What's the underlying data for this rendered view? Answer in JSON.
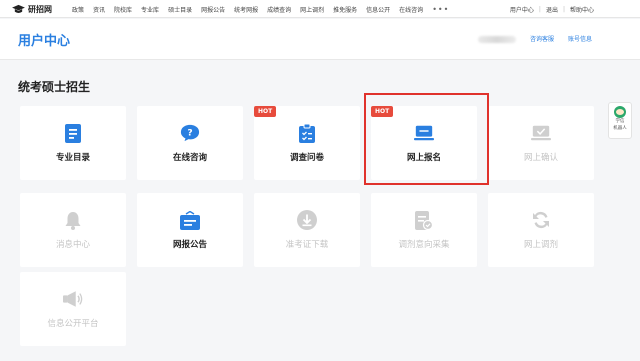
{
  "logo": {
    "text": "研招网"
  },
  "nav": {
    "items": [
      "政策",
      "资讯",
      "院校库",
      "专业库",
      "硕士目录",
      "网报公告",
      "统考网报",
      "成绩查询",
      "网上调剂",
      "推免服务",
      "信息公开",
      "在线咨询"
    ],
    "more": "•••"
  },
  "toplinks": {
    "user_center": "用户中心",
    "logout": "退出",
    "help": "帮助中心",
    "separator": "|"
  },
  "header": {
    "title": "用户中心",
    "consult_link": "咨询客服",
    "account_link": "账号信息"
  },
  "section": {
    "title": "统考硕士招生"
  },
  "cards": [
    {
      "label": "专业目录",
      "icon": "document-list-icon",
      "enabled": true
    },
    {
      "label": "在线咨询",
      "icon": "chat-question-icon",
      "enabled": true
    },
    {
      "label": "调查问卷",
      "icon": "survey-clipboard-icon",
      "enabled": true,
      "badge": "HOT"
    },
    {
      "label": "网上报名",
      "icon": "laptop-icon",
      "enabled": true,
      "badge": "HOT",
      "highlighted": true
    },
    {
      "label": "网上确认",
      "icon": "confirm-check-icon",
      "enabled": false
    },
    {
      "label": "消息中心",
      "icon": "bell-icon",
      "enabled": false
    },
    {
      "label": "网报公告",
      "icon": "notice-icon",
      "enabled": true
    },
    {
      "label": "准考证下载",
      "icon": "download-icon",
      "enabled": false
    },
    {
      "label": "调剂意向采集",
      "icon": "form-edit-icon",
      "enabled": false
    },
    {
      "label": "网上调剂",
      "icon": "refresh-icon",
      "enabled": false
    },
    {
      "label": "信息公开平台",
      "icon": "megaphone-icon",
      "enabled": false
    }
  ],
  "float_widget": {
    "line1": "学信",
    "line2": "机器人",
    "icon": "robot-avatar-icon"
  },
  "colors": {
    "accent": "#2a7fe0",
    "hot": "#e74b3c",
    "highlight_border": "#e0322c",
    "disabled": "#c4c4c4"
  }
}
